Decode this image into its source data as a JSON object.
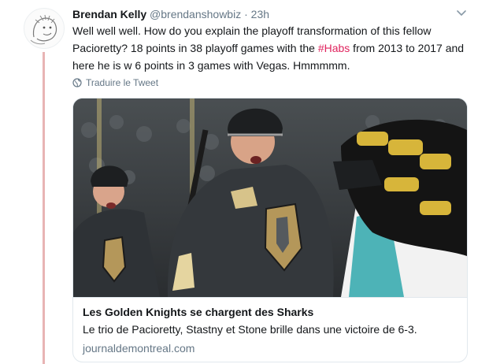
{
  "tweet": {
    "author_name": "Brendan Kelly",
    "handle": "@brendanshowbiz",
    "separator": "·",
    "time": "23h",
    "text_before": "Well well well. How do you explain the playoff transformation of this fellow Pacioretty? 18 points in 38 playoff games with the ",
    "hashtag": "#Habs",
    "text_after": " from 2013 to 2017 and here he is w 6 points in 3 games with Vegas. Hmmmmm.",
    "translate_label": "Traduire le Tweet",
    "translate_icon": "globe-icon",
    "menu_icon": "chevron-down-icon",
    "hashtag_color": "#e0245e",
    "thread_line_color": "#e8b4b4"
  },
  "card": {
    "image_subject": "hockey-celebration-photo",
    "title": "Les Golden Knights se chargent des Sharks",
    "description": "Le trio de Pacioretty, Stastny et Stone brille dans une victoire de 6-3.",
    "domain": "journaldemontreal.com"
  }
}
